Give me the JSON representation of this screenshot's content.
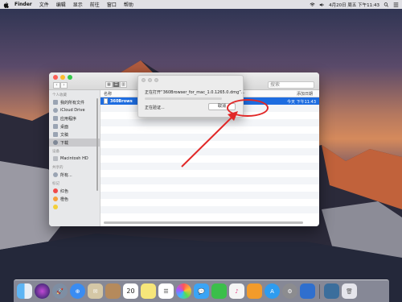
{
  "menubar": {
    "app_name": "Finder",
    "items": [
      "文件",
      "编辑",
      "显示",
      "前往",
      "窗口",
      "帮助"
    ],
    "clock": "4月20日 周五 下午11:43"
  },
  "finder": {
    "search_placeholder": "搜索",
    "sidebar": {
      "favorites_head": "个人收藏",
      "favorites": [
        "我的所有文件",
        "iCloud Drive",
        "应用程序",
        "桌面",
        "文稿",
        "下载"
      ],
      "devices_head": "设备",
      "devices": [
        "Macintosh HD"
      ],
      "shared_head": "共享的",
      "shared": [
        "所有..."
      ],
      "tags_head": "标记",
      "tags": [
        {
          "label": "红色",
          "color": "#f04b4b"
        },
        {
          "label": "橙色",
          "color": "#f6a03c"
        },
        {
          "label": "",
          "color": "#f3d03a"
        }
      ]
    },
    "columns": {
      "name": "名称",
      "date_added": "添加日期"
    },
    "selected_file": {
      "name": "360Brows",
      "date": "今天 下午11:43"
    }
  },
  "dialog": {
    "title": "正在打开“360Browser_for_mac_1.0.1265.0.dmg”...",
    "status": "正在验证...",
    "cancel_label": "取消"
  },
  "colors": {
    "annotation_red": "#e12828",
    "selection_blue": "#1d6ce0"
  },
  "dock": {
    "calendar_day": "20",
    "icons": [
      "finder-icon",
      "siri-icon",
      "launchpad-icon",
      "safari-icon",
      "mail-icon",
      "contacts-icon",
      "calendar-icon",
      "notes-icon",
      "reminders-icon",
      "photos-icon",
      "messages-icon",
      "facetime-icon",
      "itunes-icon",
      "ibooks-icon",
      "app-store-icon",
      "system-preferences-icon",
      "keynote-icon",
      "trash-icon"
    ]
  }
}
